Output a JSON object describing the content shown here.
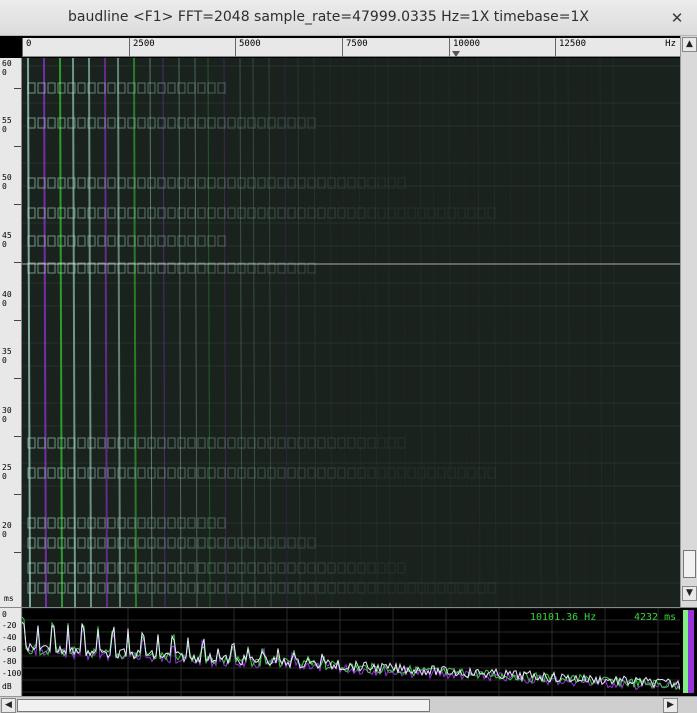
{
  "window": {
    "title": "baudline  <F1> FFT=2048 sample_rate=47999.0335 Hz=1X timebase=1X",
    "close_glyph": "✕"
  },
  "freq_axis": {
    "ticks": [
      "0",
      "2500",
      "5000",
      "7500",
      "10000",
      "12500"
    ],
    "unit": "Hz"
  },
  "time_axis": {
    "labels": [
      "600",
      "550",
      "500",
      "450",
      "400",
      "350",
      "300",
      "250",
      "200"
    ],
    "unit": "ms"
  },
  "spectrum": {
    "db_labels": [
      "0",
      "-20",
      "-40",
      "-60",
      "-80",
      "-100",
      "dB"
    ],
    "freq_readout": "10101.36 Hz",
    "time_readout": "4232 ms"
  },
  "scrollbars": {
    "up_glyph": "▲",
    "down_glyph": "▼",
    "left_glyph": "◀",
    "right_glyph": "▶"
  },
  "colors": {
    "trace_green": "#37d437",
    "trace_purple": "#9933dd",
    "trace_white": "#e8e8ff",
    "spectrogram_bg": "#1a221d"
  },
  "icons": {
    "close": "close-icon",
    "scroll_up": "arrow-up-icon",
    "scroll_down": "arrow-down-icon",
    "scroll_left": "arrow-left-icon",
    "scroll_right": "arrow-right-icon"
  }
}
